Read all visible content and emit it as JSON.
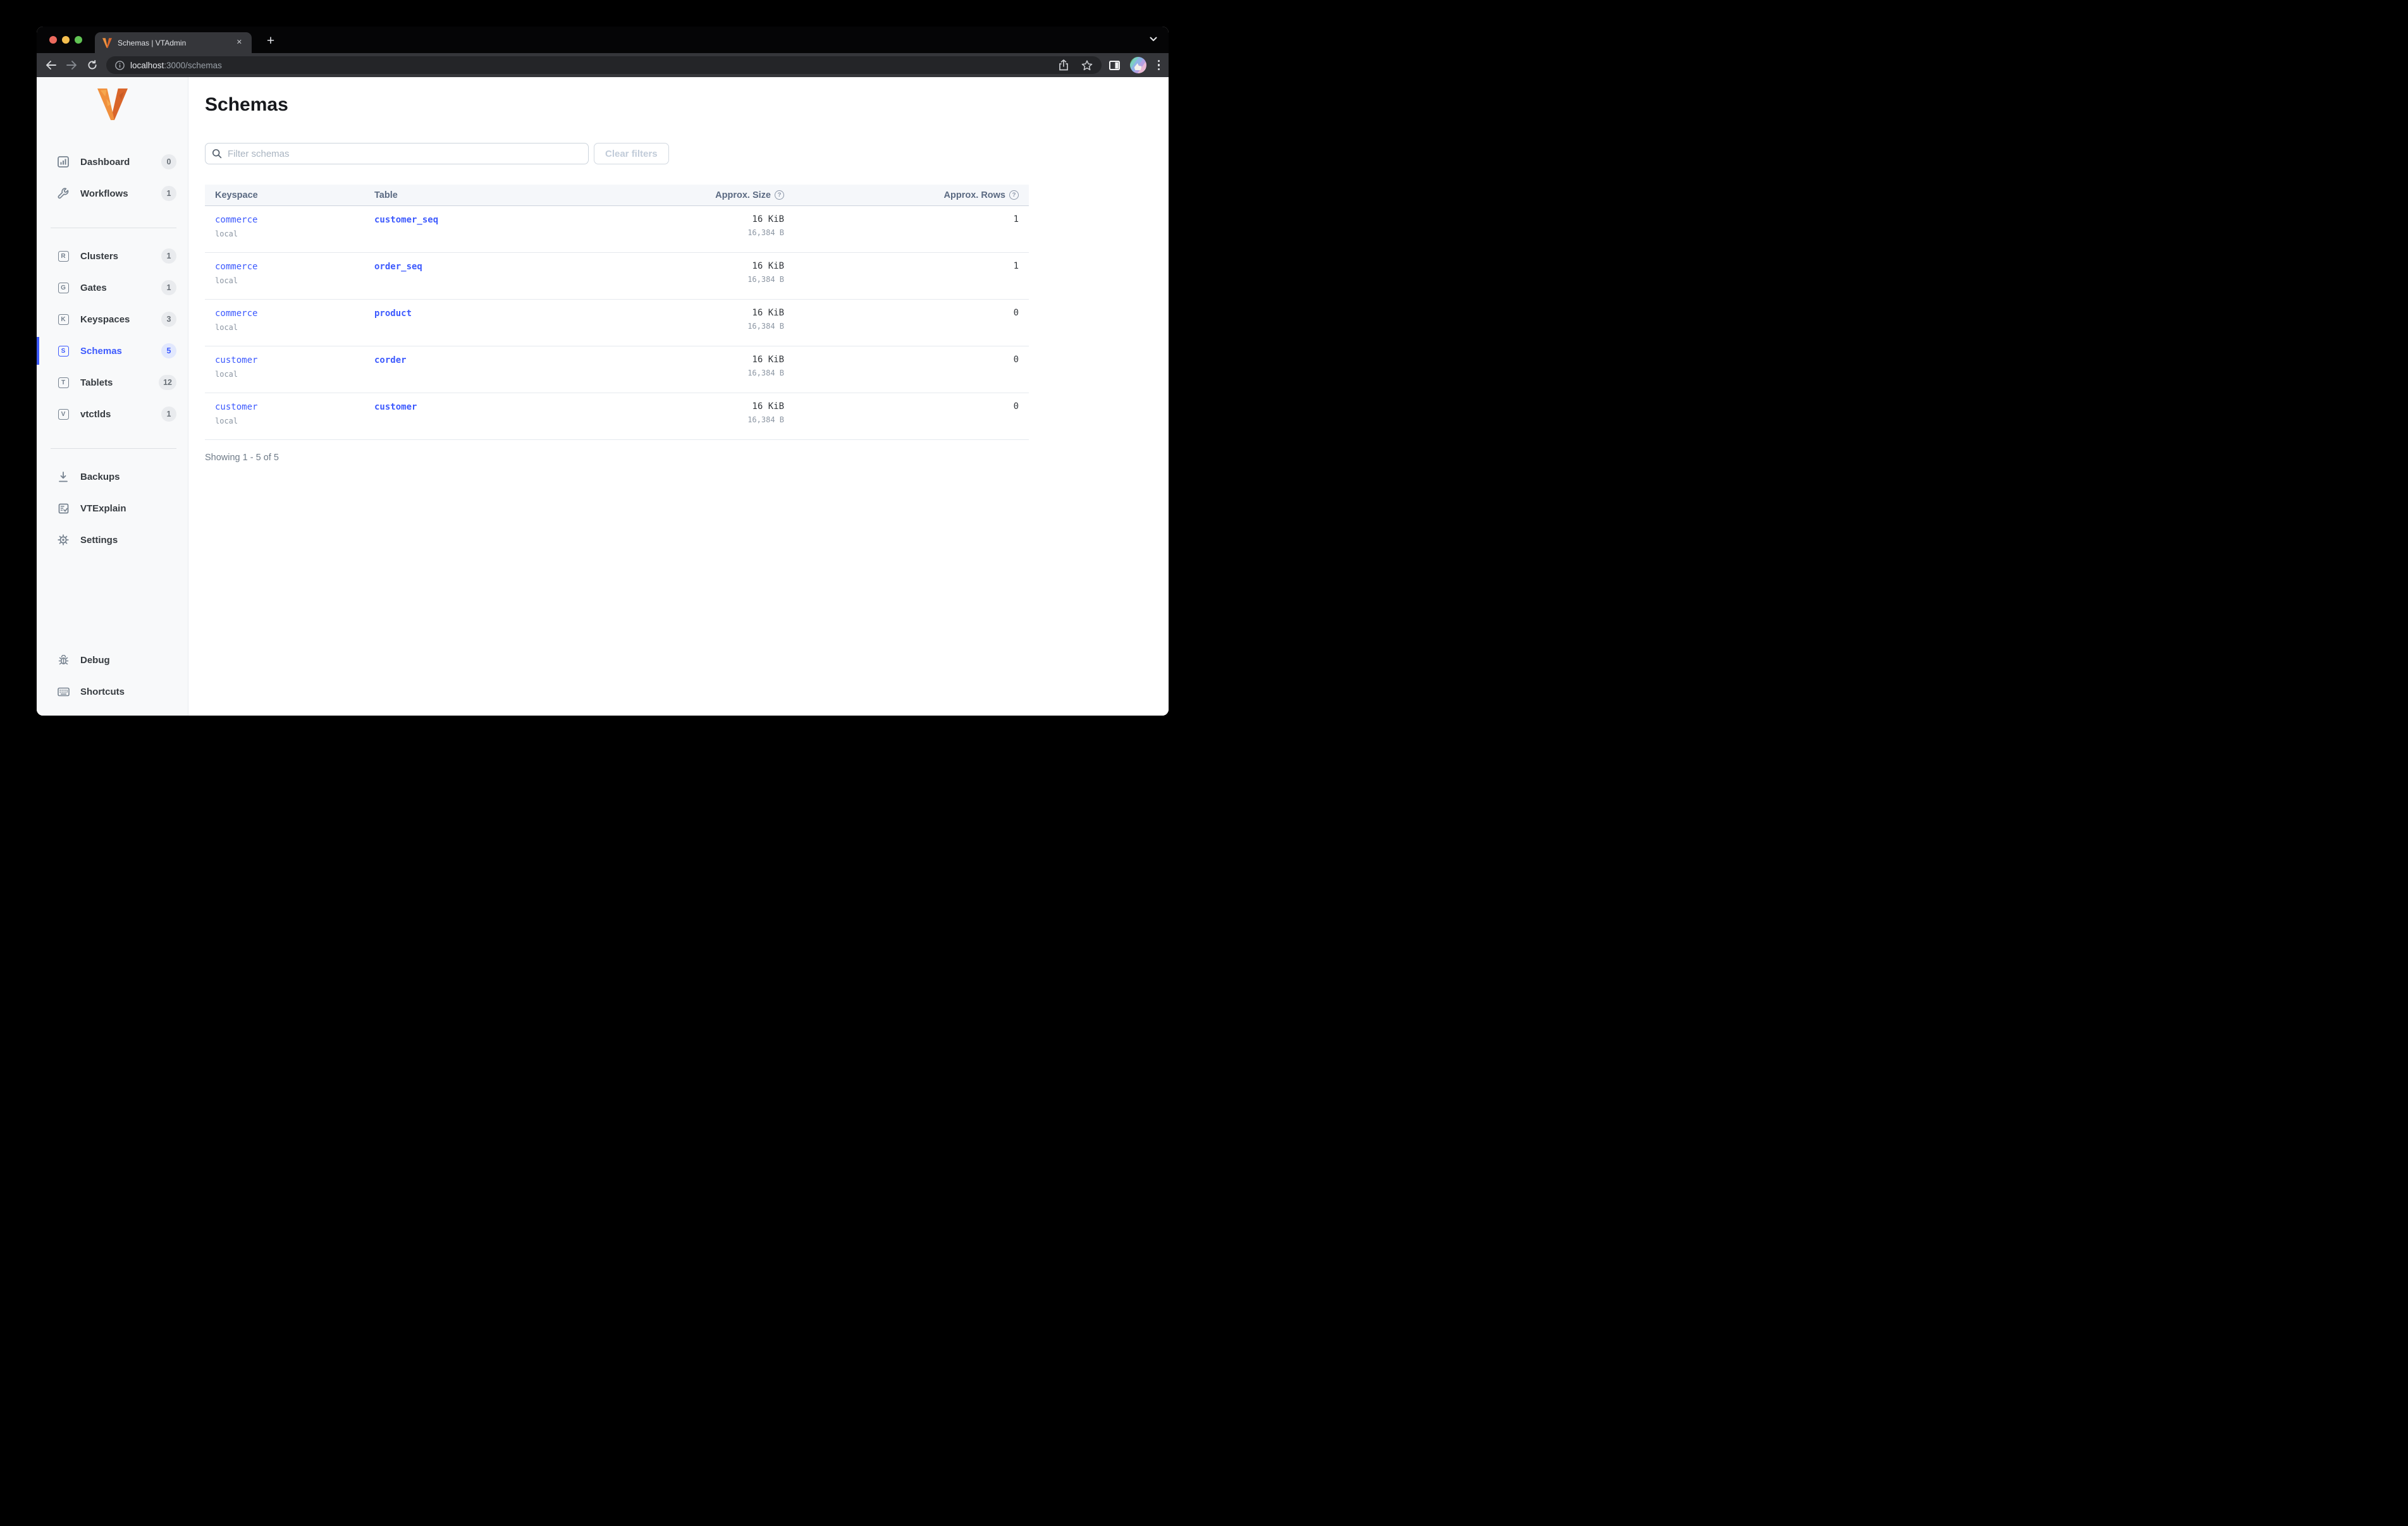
{
  "browser": {
    "tab_title": "Schemas | VTAdmin",
    "tab_close_glyph": "✕",
    "new_tab_glyph": "+",
    "url": "localhost:3000/schemas",
    "url_host": "localhost",
    "url_rest": ":3000/schemas",
    "info_glyph": "i"
  },
  "colors": {
    "accent": "#3d5afe",
    "accent_soft": "#e2e8fd",
    "logo_orange": "#f0903d",
    "logo_orange_dark": "#d9652a"
  },
  "sidebar": {
    "items": [
      {
        "label": "Dashboard",
        "badge": "0",
        "icon": "dashboard-chart"
      },
      {
        "label": "Workflows",
        "badge": "1",
        "icon": "wrench"
      },
      {
        "label": "Clusters",
        "badge": "1",
        "icon_letter": "R"
      },
      {
        "label": "Gates",
        "badge": "1",
        "icon_letter": "G"
      },
      {
        "label": "Keyspaces",
        "badge": "3",
        "icon_letter": "K"
      },
      {
        "label": "Schemas",
        "badge": "5",
        "icon_letter": "S",
        "active": true
      },
      {
        "label": "Tablets",
        "badge": "12",
        "icon_letter": "T"
      },
      {
        "label": "vtctlds",
        "badge": "1",
        "icon_letter": "V"
      },
      {
        "label": "Backups",
        "icon": "download"
      },
      {
        "label": "VTExplain",
        "icon": "document-check"
      },
      {
        "label": "Settings",
        "icon": "gear"
      },
      {
        "label": "Debug",
        "icon": "bug"
      },
      {
        "label": "Shortcuts",
        "icon": "keyboard"
      }
    ]
  },
  "main": {
    "title": "Schemas",
    "filter_placeholder": "Filter schemas",
    "clear_button_label": "Clear filters",
    "help_glyph": "?",
    "footer": "Showing 1 - 5 of 5"
  },
  "table": {
    "columns": [
      "Keyspace",
      "Table",
      "Approx. Size",
      "Approx. Rows"
    ],
    "rows": [
      {
        "keyspace": "commerce",
        "cluster": "local",
        "table": "customer_seq",
        "size": "16 KiB",
        "size_bytes": "16,384 B",
        "rows": "1"
      },
      {
        "keyspace": "commerce",
        "cluster": "local",
        "table": "order_seq",
        "size": "16 KiB",
        "size_bytes": "16,384 B",
        "rows": "1"
      },
      {
        "keyspace": "commerce",
        "cluster": "local",
        "table": "product",
        "size": "16 KiB",
        "size_bytes": "16,384 B",
        "rows": "0"
      },
      {
        "keyspace": "customer",
        "cluster": "local",
        "table": "corder",
        "size": "16 KiB",
        "size_bytes": "16,384 B",
        "rows": "0"
      },
      {
        "keyspace": "customer",
        "cluster": "local",
        "table": "customer",
        "size": "16 KiB",
        "size_bytes": "16,384 B",
        "rows": "0"
      }
    ]
  }
}
